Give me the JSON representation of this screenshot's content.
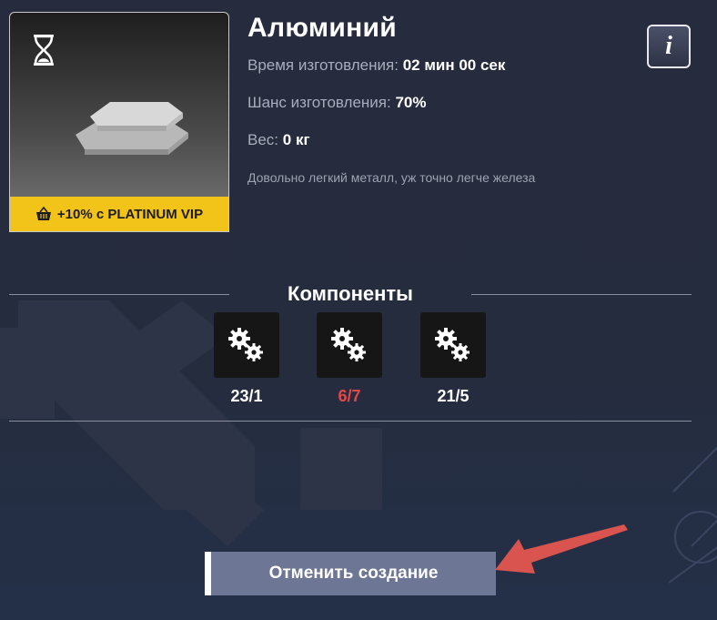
{
  "item": {
    "title": "Алюминий",
    "time_label": "Время изготовления:",
    "time_value": "02 мин 00 сек",
    "chance_label": "Шанс изготовления:",
    "chance_value": "70%",
    "weight_label": "Вес:",
    "weight_value": "0 кг",
    "description": "Довольно легкий металл, уж точно легче железа",
    "vip_text": "+10% с PLATINUM VIP"
  },
  "info_button": {
    "label": "i"
  },
  "components": {
    "title": "Компоненты",
    "items": [
      {
        "icon": "gears-icon",
        "count": "23/1",
        "color": "#ffffff"
      },
      {
        "icon": "gears-icon",
        "count": "6/7",
        "color": "#e34848"
      },
      {
        "icon": "gears-icon",
        "count": "21/5",
        "color": "#ffffff"
      }
    ]
  },
  "action": {
    "cancel_label": "Отменить создание"
  },
  "colors": {
    "vip": "#f2c319",
    "insufficient": "#e34848",
    "button": "#6d7694",
    "arrow": "#d9534f"
  }
}
